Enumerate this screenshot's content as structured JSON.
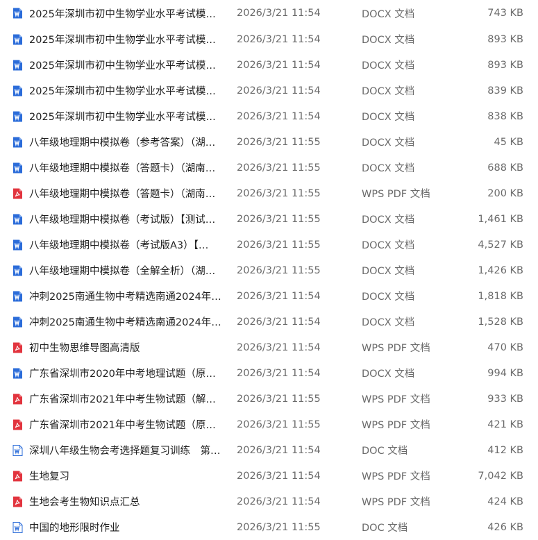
{
  "colors": {
    "docx_icon": "#2b6cd9",
    "doc_icon": "#2b6cd9",
    "pdf_icon": "#e2343e",
    "name_text": "#1f1f1f",
    "meta_text": "#6b6b6b"
  },
  "files": [
    {
      "name": "2025年深圳市初中生物学业水平考试模…",
      "date": "2026/3/21 11:54",
      "type": "DOCX 文档",
      "size": "743 KB",
      "icon": "word-docx-icon"
    },
    {
      "name": "2025年深圳市初中生物学业水平考试模…",
      "date": "2026/3/21 11:54",
      "type": "DOCX 文档",
      "size": "893 KB",
      "icon": "word-docx-icon"
    },
    {
      "name": "2025年深圳市初中生物学业水平考试模…",
      "date": "2026/3/21 11:54",
      "type": "DOCX 文档",
      "size": "893 KB",
      "icon": "word-docx-icon"
    },
    {
      "name": "2025年深圳市初中生物学业水平考试模…",
      "date": "2026/3/21 11:54",
      "type": "DOCX 文档",
      "size": "839 KB",
      "icon": "word-docx-icon"
    },
    {
      "name": "2025年深圳市初中生物学业水平考试模…",
      "date": "2026/3/21 11:54",
      "type": "DOCX 文档",
      "size": "838 KB",
      "icon": "word-docx-icon"
    },
    {
      "name": "八年级地理期中模拟卷（参考答案）（湖…",
      "date": "2026/3/21 11:55",
      "type": "DOCX 文档",
      "size": "45 KB",
      "icon": "word-docx-icon"
    },
    {
      "name": "八年级地理期中模拟卷（答题卡）（湖南…",
      "date": "2026/3/21 11:55",
      "type": "DOCX 文档",
      "size": "688 KB",
      "icon": "word-docx-icon"
    },
    {
      "name": "八年级地理期中模拟卷（答题卡）（湖南…",
      "date": "2026/3/21 11:55",
      "type": "WPS PDF 文档",
      "size": "200 KB",
      "icon": "pdf-icon"
    },
    {
      "name": "八年级地理期中模拟卷（考试版）【测试…",
      "date": "2026/3/21 11:55",
      "type": "DOCX 文档",
      "size": "1,461 KB",
      "icon": "word-docx-icon"
    },
    {
      "name": "八年级地理期中模拟卷（考试版A3）【…",
      "date": "2026/3/21 11:55",
      "type": "DOCX 文档",
      "size": "4,527 KB",
      "icon": "word-docx-icon"
    },
    {
      "name": "八年级地理期中模拟卷（全解全析）（湖…",
      "date": "2026/3/21 11:55",
      "type": "DOCX 文档",
      "size": "1,426 KB",
      "icon": "word-docx-icon"
    },
    {
      "name": "冲刺2025南通生物中考精选南通2024年…",
      "date": "2026/3/21 11:54",
      "type": "DOCX 文档",
      "size": "1,818 KB",
      "icon": "word-docx-icon"
    },
    {
      "name": "冲刺2025南通生物中考精选南通2024年…",
      "date": "2026/3/21 11:54",
      "type": "DOCX 文档",
      "size": "1,528 KB",
      "icon": "word-docx-icon"
    },
    {
      "name": "初中生物思维导图高清版",
      "date": "2026/3/21 11:54",
      "type": "WPS PDF 文档",
      "size": "470 KB",
      "icon": "pdf-icon"
    },
    {
      "name": "广东省深圳市2020年中考地理试题（原…",
      "date": "2026/3/21 11:54",
      "type": "DOCX 文档",
      "size": "994 KB",
      "icon": "word-docx-icon"
    },
    {
      "name": "广东省深圳市2021年中考生物试题（解…",
      "date": "2026/3/21 11:55",
      "type": "WPS PDF 文档",
      "size": "933 KB",
      "icon": "pdf-icon"
    },
    {
      "name": "广东省深圳市2021年中考生物试题（原…",
      "date": "2026/3/21 11:55",
      "type": "WPS PDF 文档",
      "size": "421 KB",
      "icon": "pdf-icon"
    },
    {
      "name": "深圳八年级生物会考选择题复习训练　第…",
      "date": "2026/3/21 11:54",
      "type": "DOC 文档",
      "size": "412 KB",
      "icon": "word-doc-icon"
    },
    {
      "name": "生地复习",
      "date": "2026/3/21 11:54",
      "type": "WPS PDF 文档",
      "size": "7,042 KB",
      "icon": "pdf-icon"
    },
    {
      "name": "生地会考生物知识点汇总",
      "date": "2026/3/21 11:54",
      "type": "WPS PDF 文档",
      "size": "424 KB",
      "icon": "pdf-icon"
    },
    {
      "name": "中国的地形限时作业",
      "date": "2026/3/21 11:55",
      "type": "DOC 文档",
      "size": "426 KB",
      "icon": "word-doc-icon"
    }
  ]
}
